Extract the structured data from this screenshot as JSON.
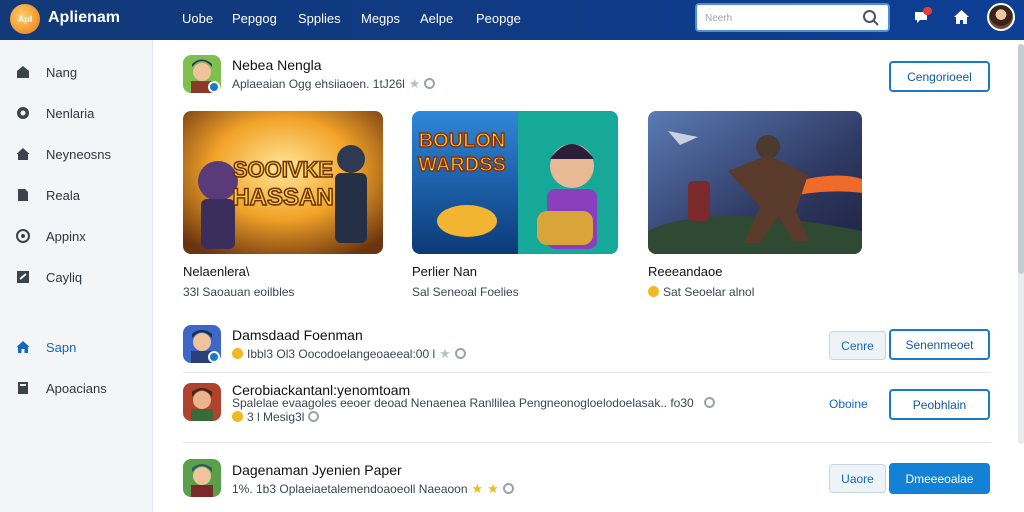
{
  "header": {
    "logo_text": "Apl",
    "app_title": "Aplienam",
    "nav": [
      "Uobe",
      "Pepgog",
      "Spplies",
      "Megps",
      "Aelpe",
      "Peopge"
    ],
    "search_placeholder": "Neerh"
  },
  "sidebar": {
    "items": [
      {
        "label": "Nang",
        "icon": "home-outline-icon"
      },
      {
        "label": "Nenlaria",
        "icon": "compass-icon"
      },
      {
        "label": "Neyneosns",
        "icon": "home-icon"
      },
      {
        "label": "Reala",
        "icon": "file-icon"
      },
      {
        "label": "Appinx",
        "icon": "settings-icon"
      },
      {
        "label": "Cayliq",
        "icon": "flag-icon"
      },
      {
        "label": "Sapn",
        "icon": "home-filled-icon",
        "active": true
      },
      {
        "label": "Apoacians",
        "icon": "book-icon"
      }
    ]
  },
  "featured": {
    "title": "Nebea Nengla",
    "subtitle": "Aplaeaian Ogg ehsiiaoen. 1tJ26l",
    "button": "Cengorioeel",
    "cards": [
      {
        "title": "Nelaenlera\\",
        "subtitle": "33l Saoauan eoilbles",
        "art_text_1": "SOOIVKE",
        "art_text_2": "HASSAN"
      },
      {
        "title": "Perlier Nan",
        "subtitle": "Sal Seneoal Foelies",
        "art_text_1": "BOULON",
        "art_text_2": "WARDSS"
      },
      {
        "title": "Reeeandaoe",
        "subtitle": "Sat Seoelar alnol"
      }
    ]
  },
  "list": [
    {
      "title": "Damsdaad Foenman",
      "meta": "Ibbl3 Ol3  Oocodoelangeoaeeal:00 l",
      "secondary_button": "Cenre",
      "primary_button": "Senenmeoet"
    },
    {
      "title": "Cerobiackantanl:yenomtoam",
      "desc": "Spalelae evaagoles eeoer deoad Nenaenea Ranllilea Pengneonogloelodoelasak.. fo30",
      "meta": "3 l Mesig3l",
      "secondary_button": "Oboine",
      "primary_button": "Peobhlain"
    },
    {
      "title": "Dagenaman Jyenien Paper",
      "meta": "1%. 1b3  Oplaeiaetalemendoaoeoll Naeaoon",
      "secondary_button": "Uaore",
      "primary_button": "Dmeeeoalae"
    }
  ],
  "colors": {
    "topbar": "#0f3a86",
    "accent": "#1281d6",
    "sidebar_bg": "#f4f5f7",
    "star": "#f2b81f"
  }
}
